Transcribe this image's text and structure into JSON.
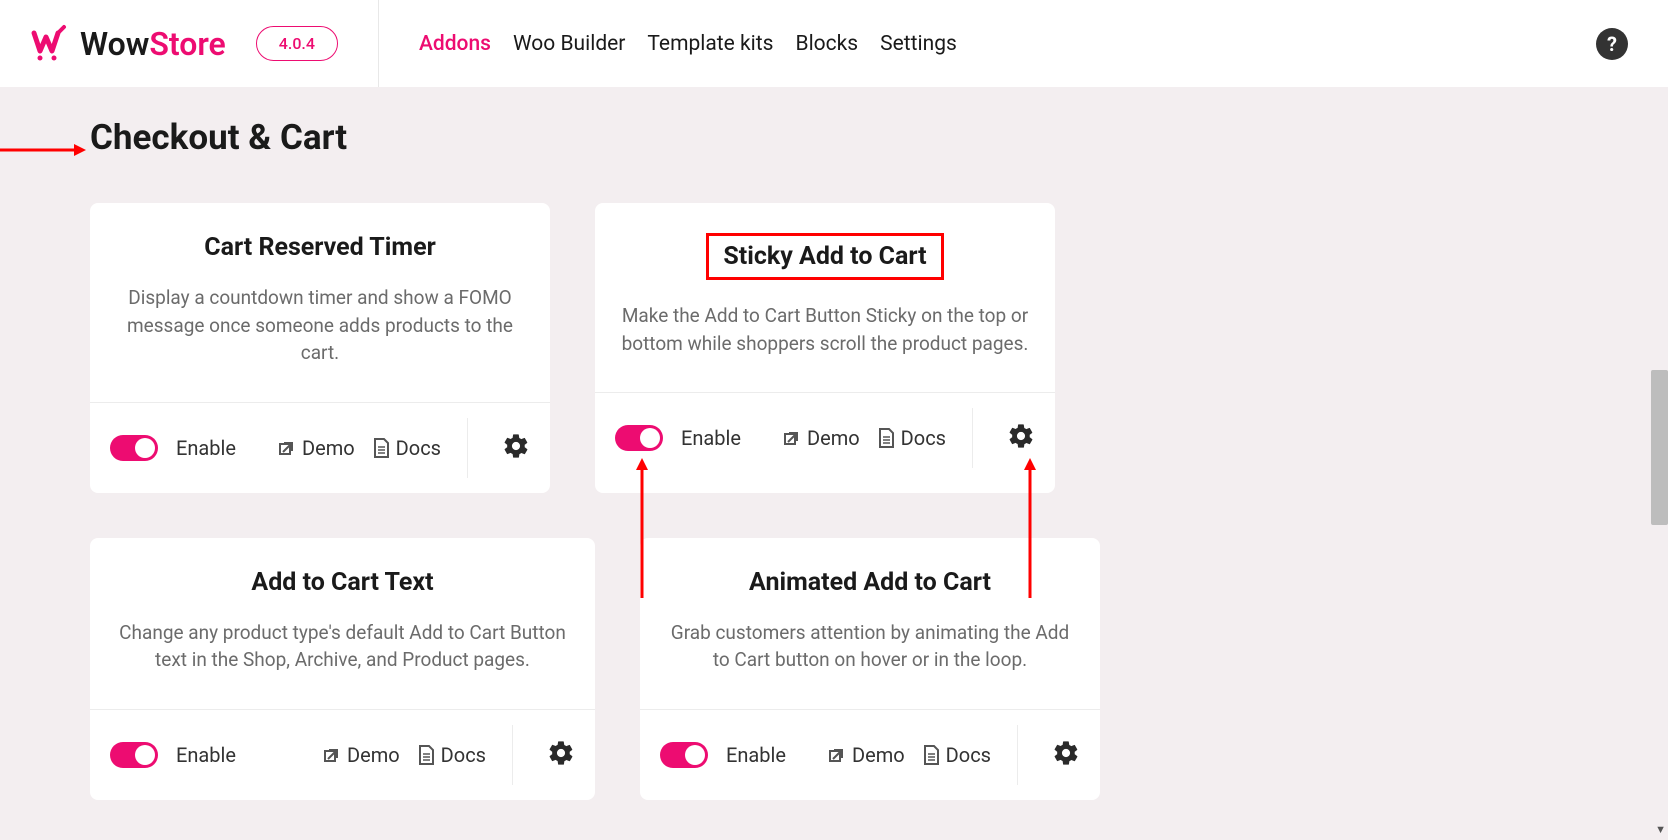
{
  "header": {
    "brand_prefix": "Wow",
    "brand_suffix": "Store",
    "version": "4.0.4",
    "nav": [
      "Addons",
      "Woo Builder",
      "Template kits",
      "Blocks",
      "Settings"
    ],
    "active_nav_index": 0
  },
  "section_title": "Checkout & Cart",
  "cards": [
    {
      "title": "Cart Reserved Timer",
      "desc": "Display a countdown timer and show a FOMO message once someone adds products to the cart.",
      "enable_label": "Enable",
      "demo_label": "Demo",
      "docs_label": "Docs",
      "highlighted": false
    },
    {
      "title": "Sticky Add to Cart",
      "desc": "Make the Add to Cart Button Sticky on the top or bottom while shoppers scroll the product pages.",
      "enable_label": "Enable",
      "demo_label": "Demo",
      "docs_label": "Docs",
      "highlighted": true
    },
    {
      "title": "Add to Cart Text",
      "desc": "Change any product type's default Add to Cart Button text in the Shop, Archive, and Product pages.",
      "enable_label": "Enable",
      "demo_label": "Demo",
      "docs_label": "Docs",
      "highlighted": false
    },
    {
      "title": "Animated Add to Cart",
      "desc": "Grab customers attention by animating the Add to Cart button on hover or in the loop.",
      "enable_label": "Enable",
      "demo_label": "Demo",
      "docs_label": "Docs",
      "highlighted": false
    }
  ]
}
